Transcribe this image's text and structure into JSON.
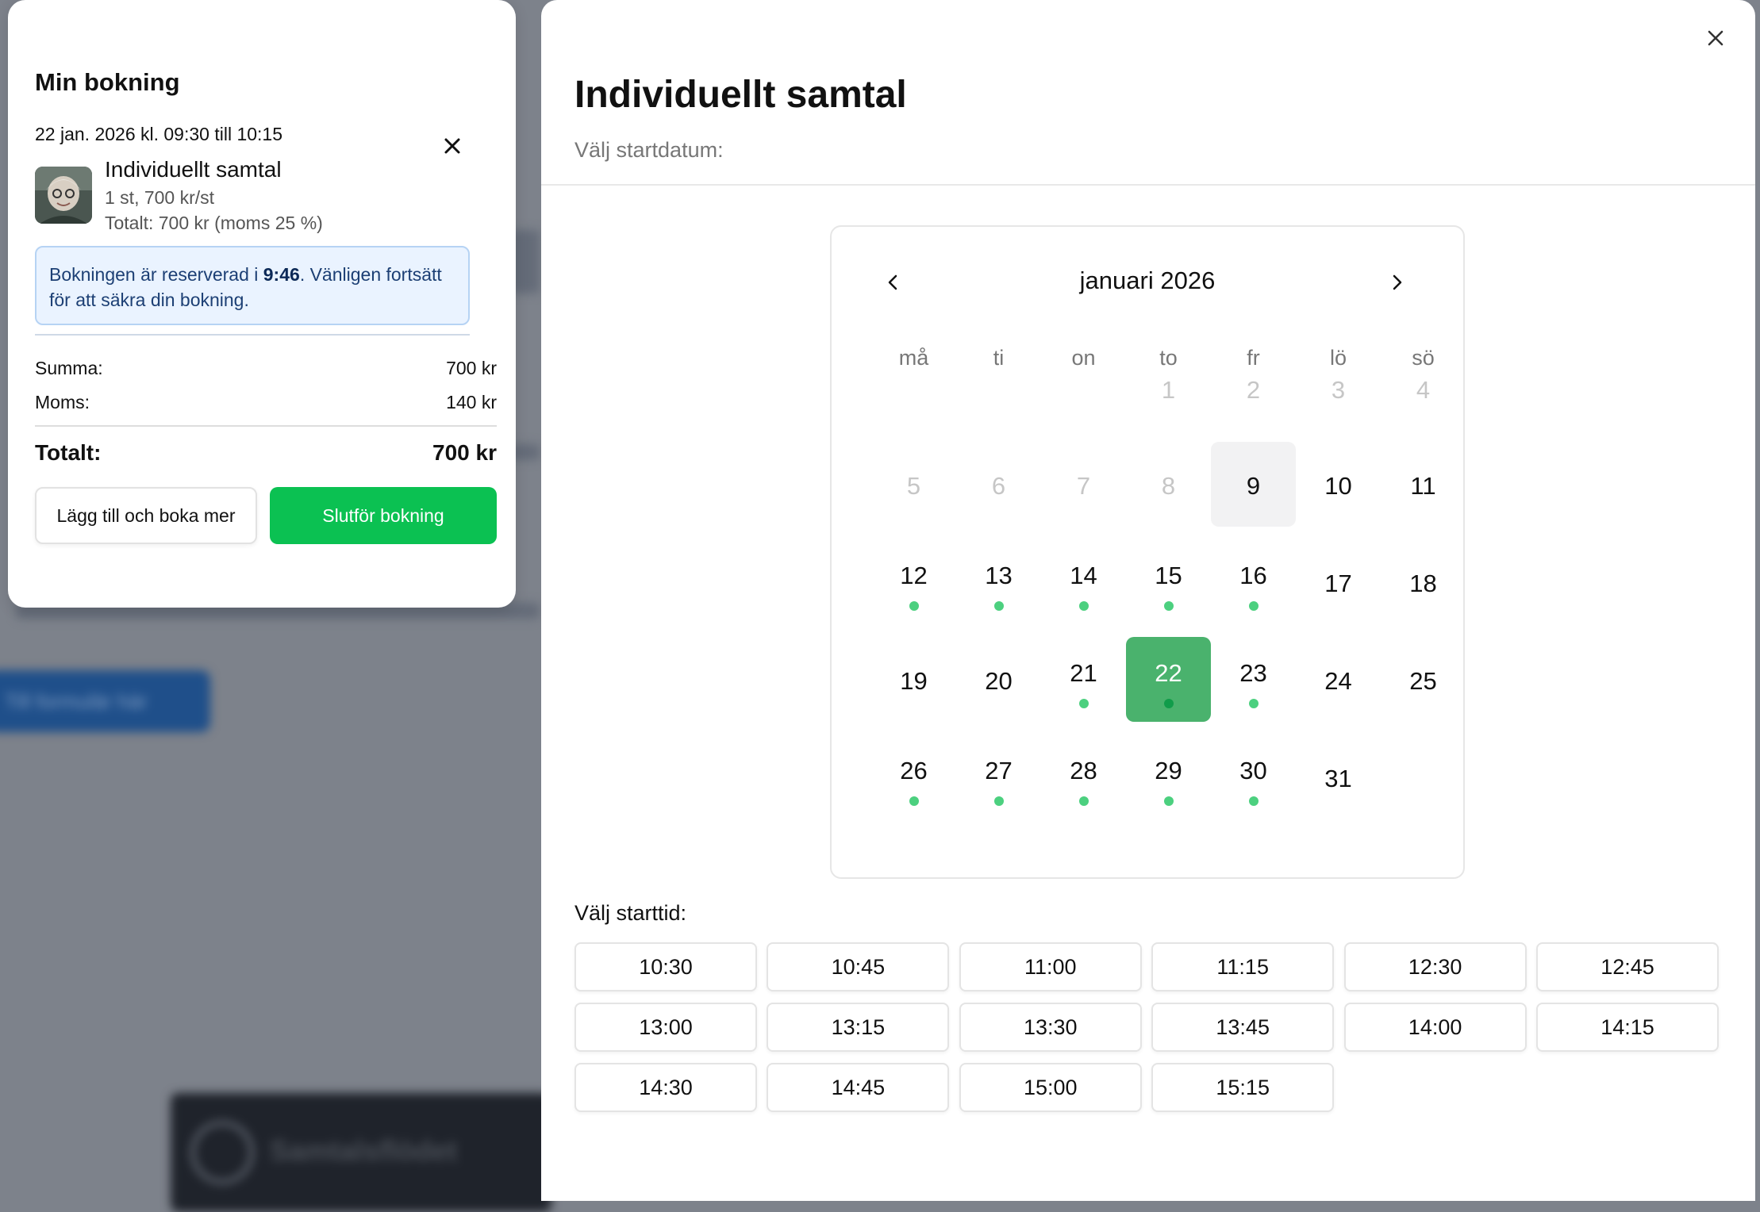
{
  "background": {
    "button_label": "Till formulär här",
    "footer_label": "Samtalsflödet"
  },
  "booking": {
    "title": "Min bokning",
    "datetime": "22 jan. 2026 kl. 09:30 till 10:15",
    "item": {
      "name": "Individuellt samtal",
      "quantity": "1 st, 700 kr/st",
      "total": "Totalt: 700 kr (moms 25 %)"
    },
    "notice": {
      "prefix": "Bokningen är reserverad i ",
      "time": "9:46",
      "suffix": ". Vänligen fortsätt för att säkra din bokning."
    },
    "sum_label": "Summa:",
    "sum_value": "700 kr",
    "vat_label": "Moms:",
    "vat_value": "140 kr",
    "total_label": "Totalt:",
    "total_value": "700 kr",
    "add_button": "Lägg till och boka mer",
    "finish_button": "Slutför bokning"
  },
  "modal": {
    "title": "Individuellt samtal",
    "subtitle": "Välj startdatum:",
    "calendar": {
      "month": "januari 2026",
      "weekdays": [
        "må",
        "ti",
        "on",
        "to",
        "fr",
        "lö",
        "sö"
      ],
      "weeks": [
        [
          null,
          null,
          null,
          {
            "d": "1",
            "s": "disabled"
          },
          {
            "d": "2",
            "s": "disabled"
          },
          {
            "d": "3",
            "s": "disabled"
          },
          {
            "d": "4",
            "s": "disabled"
          }
        ],
        [
          {
            "d": "5",
            "s": "disabled"
          },
          {
            "d": "6",
            "s": "disabled"
          },
          {
            "d": "7",
            "s": "disabled"
          },
          {
            "d": "8",
            "s": "disabled"
          },
          {
            "d": "9",
            "s": "today"
          },
          {
            "d": "10"
          },
          {
            "d": "11"
          }
        ],
        [
          {
            "d": "12",
            "a": true
          },
          {
            "d": "13",
            "a": true
          },
          {
            "d": "14",
            "a": true
          },
          {
            "d": "15",
            "a": true
          },
          {
            "d": "16",
            "a": true
          },
          {
            "d": "17"
          },
          {
            "d": "18"
          }
        ],
        [
          {
            "d": "19"
          },
          {
            "d": "20"
          },
          {
            "d": "21",
            "a": true
          },
          {
            "d": "22",
            "a": true,
            "s": "selected"
          },
          {
            "d": "23",
            "a": true
          },
          {
            "d": "24"
          },
          {
            "d": "25"
          }
        ],
        [
          {
            "d": "26",
            "a": true
          },
          {
            "d": "27",
            "a": true
          },
          {
            "d": "28",
            "a": true
          },
          {
            "d": "29",
            "a": true
          },
          {
            "d": "30",
            "a": true
          },
          {
            "d": "31"
          },
          null
        ]
      ]
    },
    "time_label": "Välj starttid:",
    "times": [
      "10:30",
      "10:45",
      "11:00",
      "11:15",
      "12:30",
      "12:45",
      "13:00",
      "13:15",
      "13:30",
      "13:45",
      "14:00",
      "14:15",
      "14:30",
      "14:45",
      "15:00",
      "15:15"
    ]
  }
}
